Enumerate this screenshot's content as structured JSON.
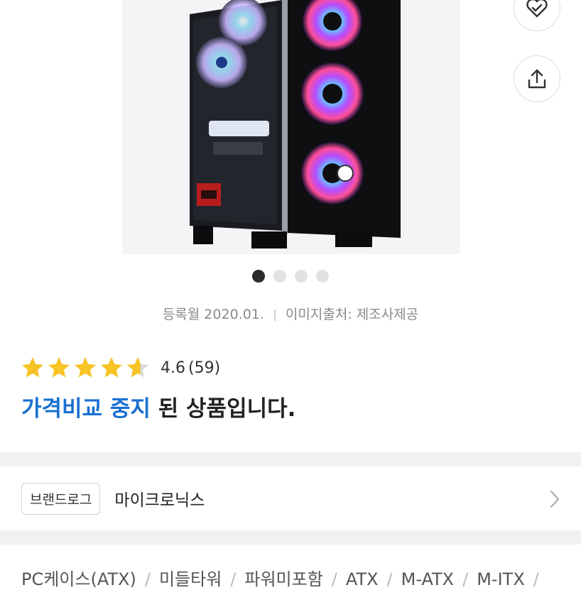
{
  "gallery": {
    "total_images": 4,
    "active_index": 0
  },
  "meta": {
    "registered": "등록월 2020.01.",
    "image_source": "이미지출처: 제조사제공"
  },
  "rating": {
    "score": "4.6",
    "count": "(59)",
    "value": 4.6,
    "max": 5
  },
  "status": {
    "highlight": "가격비교 중지",
    "rest": " 된 상품입니다."
  },
  "brand": {
    "tag_label": "브랜드로그",
    "name": "마이크로닉스"
  },
  "categories": [
    "PC케이스(ATX)",
    "미들타워",
    "파워미포함",
    "ATX",
    "M-ATX",
    "M-ITX"
  ],
  "icons": {
    "favorite": "heart-check-icon",
    "share": "share-icon",
    "chevron": "chevron-right-icon"
  },
  "colors": {
    "accent": "#1a6fd1",
    "star": "#f7c325"
  }
}
